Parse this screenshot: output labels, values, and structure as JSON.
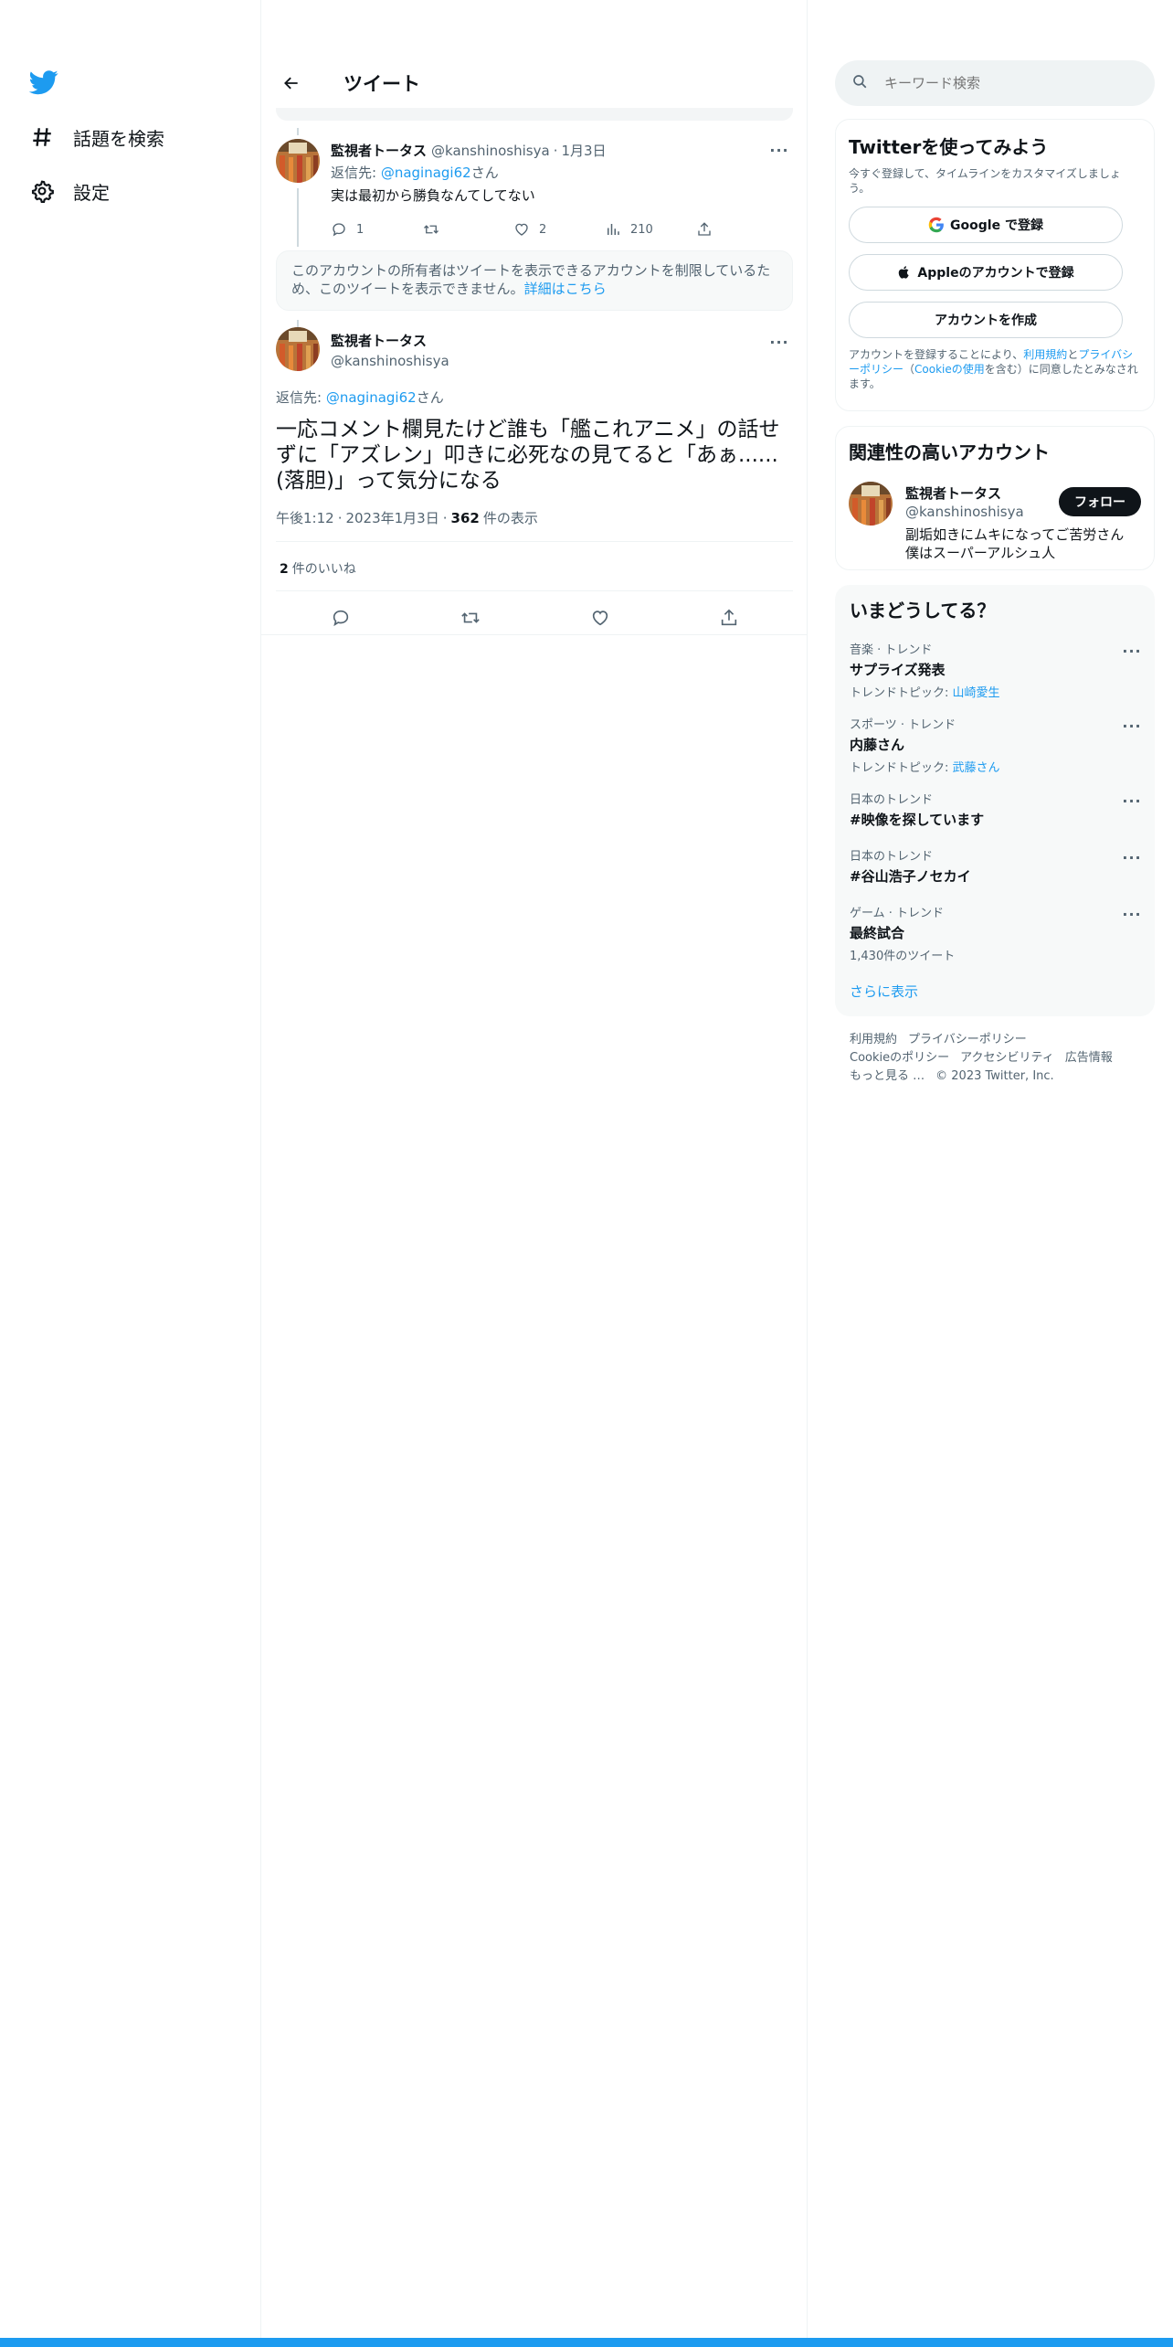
{
  "colors": {
    "accent": "#1d9bf0",
    "text": "#0f1419",
    "muted": "#536471",
    "bottom_bar": "#1d9bf0"
  },
  "nav": {
    "logo": "twitter-bird-icon",
    "items": [
      {
        "icon": "hashtag-icon",
        "label": "話題を検索"
      },
      {
        "icon": "gear-icon",
        "label": "設定"
      }
    ]
  },
  "header": {
    "title": "ツイート"
  },
  "reply_tweet": {
    "name": "監視者トータス",
    "handle": "@kanshinoshisya",
    "date": "1月3日",
    "reply_prefix": "返信先: ",
    "reply_to": "@naginagi62",
    "reply_suffix": "さん",
    "text": "実は最初から勝負なんてしてない",
    "reply_count": "1",
    "retweet_count": "",
    "like_count": "2",
    "view_count": "210"
  },
  "notice": {
    "text": "このアカウントの所有者はツイートを表示できるアカウントを制限しているため、このツイートを表示できません。",
    "link": "詳細はこちら"
  },
  "main_tweet": {
    "name": "監視者トータス",
    "handle": "@kanshinoshisya",
    "reply_prefix": "返信先: ",
    "reply_to": "@naginagi62",
    "reply_suffix": "さん",
    "text": "一応コメント欄見たけど誰も「艦これアニメ」の話せずに「アズレン」叩きに必死なの見てると「あぁ......(落胆)」って気分になる",
    "time": "午後1:12",
    "date": "2023年1月3日",
    "views": "362",
    "views_label": "件の表示",
    "likes": "2",
    "likes_label": "件のいいね"
  },
  "search": {
    "placeholder": "キーワード検索"
  },
  "join": {
    "title": "Twitterを使ってみよう",
    "subtitle": "今すぐ登録して、タイムラインをカスタマイズしましょう。",
    "google": "Google で登録",
    "apple": "Appleのアカウントで登録",
    "create": "アカウントを作成",
    "terms_a": "アカウントを登録することにより、",
    "terms_link1": "利用規約",
    "terms_b": "と",
    "terms_link2": "プライバシーポリシー",
    "terms_c": "（",
    "terms_link3": "Cookieの使用",
    "terms_d": "を含む）に同意したとみなされます。"
  },
  "related": {
    "title": "関連性の高いアカウント",
    "name": "監視者トータス",
    "handle": "@kanshinoshisya",
    "bio": "副垢如きにムキになってご苦労さん 僕はスーパーアルシュ人",
    "follow": "フォロー"
  },
  "trends": {
    "title": "いまどうしてる？",
    "items": [
      {
        "context": "音楽 · トレンド",
        "title": "サプライズ発表",
        "topic_prefix": "トレンドトピック: ",
        "topic": "山崎愛生"
      },
      {
        "context": "スポーツ · トレンド",
        "title": "内藤さん",
        "topic_prefix": "トレンドトピック: ",
        "topic": "武藤さん"
      },
      {
        "context": "日本のトレンド",
        "title": "#映像を探しています"
      },
      {
        "context": "日本のトレンド",
        "title": "#谷山浩子ノセカイ"
      },
      {
        "context": "ゲーム · トレンド",
        "title": "最終試合",
        "count": "1,430件のツイート"
      }
    ],
    "show_more": "さらに表示"
  },
  "footer": {
    "terms": "利用規約",
    "privacy": "プライバシーポリシー",
    "cookie": "Cookieのポリシー",
    "accessibility": "アクセシビリティ",
    "ads": "広告情報",
    "more": "もっと見る …",
    "copyright": "© 2023 Twitter, Inc."
  }
}
